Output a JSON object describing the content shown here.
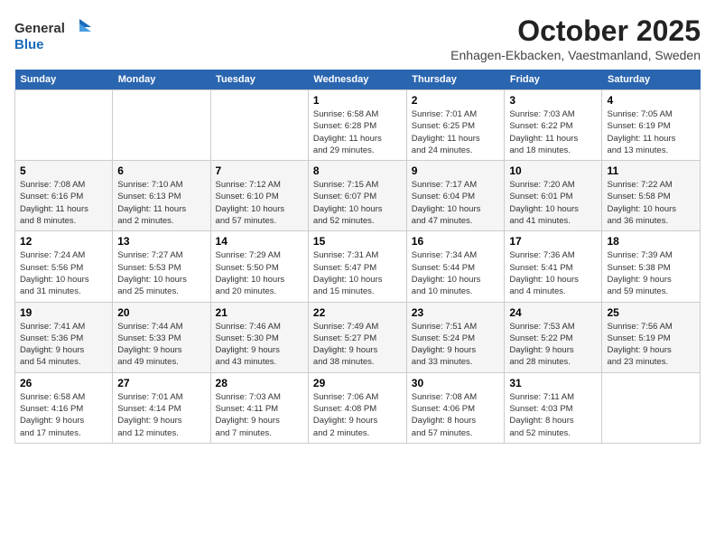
{
  "header": {
    "logo_general": "General",
    "logo_blue": "Blue",
    "month": "October 2025",
    "location": "Enhagen-Ekbacken, Vaestmanland, Sweden"
  },
  "days_of_week": [
    "Sunday",
    "Monday",
    "Tuesday",
    "Wednesday",
    "Thursday",
    "Friday",
    "Saturday"
  ],
  "weeks": [
    [
      {
        "day": "",
        "info": ""
      },
      {
        "day": "",
        "info": ""
      },
      {
        "day": "",
        "info": ""
      },
      {
        "day": "1",
        "info": "Sunrise: 6:58 AM\nSunset: 6:28 PM\nDaylight: 11 hours\nand 29 minutes."
      },
      {
        "day": "2",
        "info": "Sunrise: 7:01 AM\nSunset: 6:25 PM\nDaylight: 11 hours\nand 24 minutes."
      },
      {
        "day": "3",
        "info": "Sunrise: 7:03 AM\nSunset: 6:22 PM\nDaylight: 11 hours\nand 18 minutes."
      },
      {
        "day": "4",
        "info": "Sunrise: 7:05 AM\nSunset: 6:19 PM\nDaylight: 11 hours\nand 13 minutes."
      }
    ],
    [
      {
        "day": "5",
        "info": "Sunrise: 7:08 AM\nSunset: 6:16 PM\nDaylight: 11 hours\nand 8 minutes."
      },
      {
        "day": "6",
        "info": "Sunrise: 7:10 AM\nSunset: 6:13 PM\nDaylight: 11 hours\nand 2 minutes."
      },
      {
        "day": "7",
        "info": "Sunrise: 7:12 AM\nSunset: 6:10 PM\nDaylight: 10 hours\nand 57 minutes."
      },
      {
        "day": "8",
        "info": "Sunrise: 7:15 AM\nSunset: 6:07 PM\nDaylight: 10 hours\nand 52 minutes."
      },
      {
        "day": "9",
        "info": "Sunrise: 7:17 AM\nSunset: 6:04 PM\nDaylight: 10 hours\nand 47 minutes."
      },
      {
        "day": "10",
        "info": "Sunrise: 7:20 AM\nSunset: 6:01 PM\nDaylight: 10 hours\nand 41 minutes."
      },
      {
        "day": "11",
        "info": "Sunrise: 7:22 AM\nSunset: 5:58 PM\nDaylight: 10 hours\nand 36 minutes."
      }
    ],
    [
      {
        "day": "12",
        "info": "Sunrise: 7:24 AM\nSunset: 5:56 PM\nDaylight: 10 hours\nand 31 minutes."
      },
      {
        "day": "13",
        "info": "Sunrise: 7:27 AM\nSunset: 5:53 PM\nDaylight: 10 hours\nand 25 minutes."
      },
      {
        "day": "14",
        "info": "Sunrise: 7:29 AM\nSunset: 5:50 PM\nDaylight: 10 hours\nand 20 minutes."
      },
      {
        "day": "15",
        "info": "Sunrise: 7:31 AM\nSunset: 5:47 PM\nDaylight: 10 hours\nand 15 minutes."
      },
      {
        "day": "16",
        "info": "Sunrise: 7:34 AM\nSunset: 5:44 PM\nDaylight: 10 hours\nand 10 minutes."
      },
      {
        "day": "17",
        "info": "Sunrise: 7:36 AM\nSunset: 5:41 PM\nDaylight: 10 hours\nand 4 minutes."
      },
      {
        "day": "18",
        "info": "Sunrise: 7:39 AM\nSunset: 5:38 PM\nDaylight: 9 hours\nand 59 minutes."
      }
    ],
    [
      {
        "day": "19",
        "info": "Sunrise: 7:41 AM\nSunset: 5:36 PM\nDaylight: 9 hours\nand 54 minutes."
      },
      {
        "day": "20",
        "info": "Sunrise: 7:44 AM\nSunset: 5:33 PM\nDaylight: 9 hours\nand 49 minutes."
      },
      {
        "day": "21",
        "info": "Sunrise: 7:46 AM\nSunset: 5:30 PM\nDaylight: 9 hours\nand 43 minutes."
      },
      {
        "day": "22",
        "info": "Sunrise: 7:49 AM\nSunset: 5:27 PM\nDaylight: 9 hours\nand 38 minutes."
      },
      {
        "day": "23",
        "info": "Sunrise: 7:51 AM\nSunset: 5:24 PM\nDaylight: 9 hours\nand 33 minutes."
      },
      {
        "day": "24",
        "info": "Sunrise: 7:53 AM\nSunset: 5:22 PM\nDaylight: 9 hours\nand 28 minutes."
      },
      {
        "day": "25",
        "info": "Sunrise: 7:56 AM\nSunset: 5:19 PM\nDaylight: 9 hours\nand 23 minutes."
      }
    ],
    [
      {
        "day": "26",
        "info": "Sunrise: 6:58 AM\nSunset: 4:16 PM\nDaylight: 9 hours\nand 17 minutes."
      },
      {
        "day": "27",
        "info": "Sunrise: 7:01 AM\nSunset: 4:14 PM\nDaylight: 9 hours\nand 12 minutes."
      },
      {
        "day": "28",
        "info": "Sunrise: 7:03 AM\nSunset: 4:11 PM\nDaylight: 9 hours\nand 7 minutes."
      },
      {
        "day": "29",
        "info": "Sunrise: 7:06 AM\nSunset: 4:08 PM\nDaylight: 9 hours\nand 2 minutes."
      },
      {
        "day": "30",
        "info": "Sunrise: 7:08 AM\nSunset: 4:06 PM\nDaylight: 8 hours\nand 57 minutes."
      },
      {
        "day": "31",
        "info": "Sunrise: 7:11 AM\nSunset: 4:03 PM\nDaylight: 8 hours\nand 52 minutes."
      },
      {
        "day": "",
        "info": ""
      }
    ]
  ]
}
